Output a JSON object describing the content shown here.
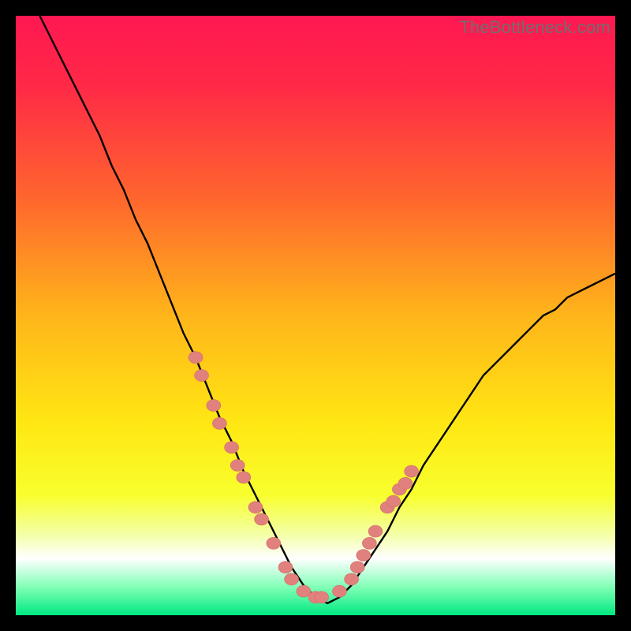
{
  "watermark": "TheBottleneck.com",
  "colors": {
    "bg": "#000000",
    "gradient_stops": [
      {
        "offset": 0.0,
        "color": "#ff1752"
      },
      {
        "offset": 0.12,
        "color": "#ff2a46"
      },
      {
        "offset": 0.3,
        "color": "#ff642e"
      },
      {
        "offset": 0.5,
        "color": "#ffb51a"
      },
      {
        "offset": 0.68,
        "color": "#ffe713"
      },
      {
        "offset": 0.8,
        "color": "#f8ff2e"
      },
      {
        "offset": 0.865,
        "color": "#f4ffa6"
      },
      {
        "offset": 0.905,
        "color": "#ffffff"
      },
      {
        "offset": 0.955,
        "color": "#7bffb4"
      },
      {
        "offset": 1.0,
        "color": "#00e880"
      }
    ],
    "curve": "#000000",
    "marker_fill": "#e0817d",
    "marker_stroke": "#d46e69"
  },
  "chart_data": {
    "type": "line",
    "title": "",
    "xlabel": "",
    "ylabel": "",
    "xlim": [
      0,
      100
    ],
    "ylim": [
      0,
      100
    ],
    "grid": false,
    "legend": false,
    "series": [
      {
        "name": "bottleneck-curve",
        "x": [
          4,
          6,
          8,
          10,
          12,
          14,
          16,
          18,
          20,
          22,
          24,
          26,
          28,
          30,
          32,
          34,
          36,
          38,
          40,
          42,
          44,
          46,
          48,
          50,
          52,
          54,
          56,
          58,
          60,
          62,
          64,
          66,
          68,
          70,
          72,
          74,
          76,
          78,
          80,
          82,
          84,
          86,
          88,
          90,
          92,
          94,
          96,
          98,
          100
        ],
        "values": [
          100,
          96,
          92,
          88,
          84,
          80,
          75,
          71,
          66,
          62,
          57,
          52,
          47,
          43,
          38,
          33,
          29,
          24,
          20,
          16,
          12,
          8,
          5,
          3,
          2,
          3,
          5,
          8,
          11,
          14,
          18,
          21,
          25,
          28,
          31,
          34,
          37,
          40,
          42,
          44,
          46,
          48,
          50,
          51,
          53,
          54,
          55,
          56,
          57
        ]
      }
    ],
    "markers_left": [
      {
        "x": 30,
        "y": 43
      },
      {
        "x": 31,
        "y": 40
      },
      {
        "x": 33,
        "y": 35
      },
      {
        "x": 34,
        "y": 32
      },
      {
        "x": 36,
        "y": 28
      },
      {
        "x": 37,
        "y": 25
      },
      {
        "x": 38,
        "y": 23
      },
      {
        "x": 40,
        "y": 18
      },
      {
        "x": 41,
        "y": 16
      },
      {
        "x": 43,
        "y": 12
      },
      {
        "x": 45,
        "y": 8
      },
      {
        "x": 46,
        "y": 6
      },
      {
        "x": 48,
        "y": 4
      },
      {
        "x": 50,
        "y": 3
      },
      {
        "x": 51,
        "y": 3
      }
    ],
    "markers_right": [
      {
        "x": 54,
        "y": 4
      },
      {
        "x": 56,
        "y": 6
      },
      {
        "x": 57,
        "y": 8
      },
      {
        "x": 58,
        "y": 10
      },
      {
        "x": 59,
        "y": 12
      },
      {
        "x": 60,
        "y": 14
      },
      {
        "x": 62,
        "y": 18
      },
      {
        "x": 63,
        "y": 19
      },
      {
        "x": 64,
        "y": 21
      },
      {
        "x": 65,
        "y": 22
      },
      {
        "x": 66,
        "y": 24
      }
    ],
    "annotations": []
  }
}
